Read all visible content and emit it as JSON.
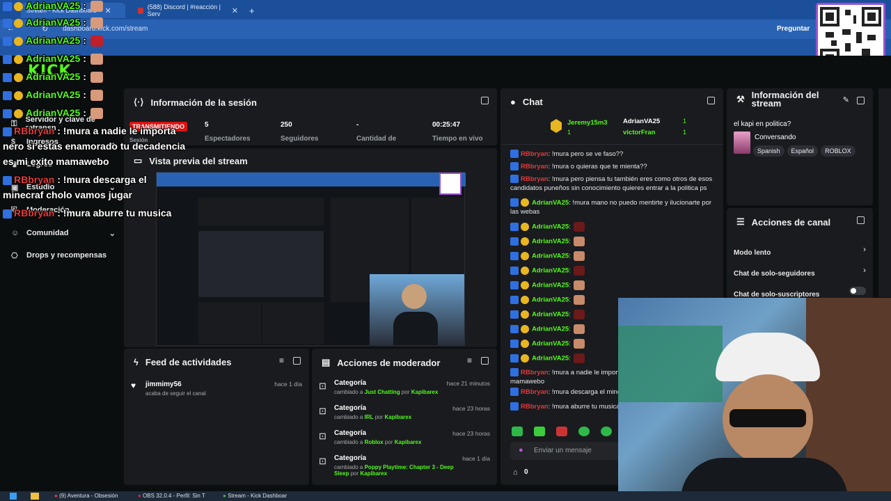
{
  "browser": {
    "tabs": [
      {
        "label": "Stream - Kick Dashboard",
        "active": true
      },
      {
        "label": "(588) Discord | #reacción | Serv",
        "active": false
      }
    ],
    "new_tab": "+",
    "url": "dashboard.kick.com/stream",
    "ask_label": "Preguntar"
  },
  "brand": {
    "logo": "KICK",
    "accent": "#53fc18"
  },
  "sidebar": {
    "items": [
      {
        "label": "Servidor y clave de retransn",
        "icon": "key-icon"
      },
      {
        "label": "Ingresos",
        "icon": "money-icon"
      },
      {
        "label": "Logros",
        "icon": "trophy-icon"
      },
      {
        "label": "Estudio",
        "icon": "studio-icon"
      },
      {
        "label": "Moderación",
        "icon": "shield-icon"
      },
      {
        "label": "Comunidad",
        "icon": "people-icon"
      },
      {
        "label": "Drops y recompensas",
        "icon": "gift-icon"
      }
    ]
  },
  "session": {
    "title": "Información de la sesión",
    "badge": "TRANSMITIENDO",
    "sub": "Sesión",
    "stats": [
      {
        "value": "5",
        "label": "Espectadores"
      },
      {
        "value": "250",
        "label": "Seguidores"
      },
      {
        "value": "-",
        "label": "Cantidad de"
      },
      {
        "value": "00:25:47",
        "label": "Tiempo en vivo"
      }
    ]
  },
  "preview": {
    "title": "Vista previa del stream"
  },
  "chat": {
    "title": "Chat",
    "top": [
      {
        "user": "Jeremy15m3",
        "count": "1"
      },
      {
        "user": "AdrianVA25",
        "count": "1"
      },
      {
        "user": "victorFran",
        "count": "1"
      }
    ],
    "messages": [
      {
        "user": "RBbryan",
        "text": ": !mura pero se ve faso??",
        "color": "red"
      },
      {
        "user": "RBbryan",
        "text": ": !mura o quieras que te mienta??",
        "color": "red"
      },
      {
        "user": "RBbryan",
        "text": ": !mura pero piensa tu también eres como otros de esos candidatos puneños sin conocimiento quieres entrar a la politica ps",
        "color": "red"
      },
      {
        "user": "AdrianVA25",
        "text": ": !mura mano no puedo mentirte y ilucionarte por las webas",
        "color": "green"
      },
      {
        "user": "AdrianVA25",
        "text": ":",
        "color": "green"
      },
      {
        "user": "AdrianVA25",
        "text": ":",
        "color": "green"
      },
      {
        "user": "AdrianVA25",
        "text": ":",
        "color": "green"
      },
      {
        "user": "AdrianVA25",
        "text": ":",
        "color": "green"
      },
      {
        "user": "AdrianVA25",
        "text": ":",
        "color": "green"
      },
      {
        "user": "AdrianVA25",
        "text": ":",
        "color": "green"
      },
      {
        "user": "AdrianVA25",
        "text": ":",
        "color": "green"
      },
      {
        "user": "AdrianVA25",
        "text": ":",
        "color": "green"
      },
      {
        "user": "AdrianVA25",
        "text": ":",
        "color": "green"
      },
      {
        "user": "AdrianVA25",
        "text": ":",
        "color": "green"
      },
      {
        "user": "RBbryan",
        "text": ": !mura a nadie le importa decadencia es mi exito mamawebo",
        "color": "red"
      },
      {
        "user": "RBbryan",
        "text": ": !mura descarga el mine",
        "color": "red"
      },
      {
        "user": "RBbryan",
        "text": ": !mura aburre tu musica",
        "color": "red"
      }
    ],
    "input_placeholder": "Enviar un mensaje",
    "points": "0"
  },
  "overlay": {
    "lines": [
      {
        "user": "AdrianVA25",
        "text": " :",
        "kind": "g"
      },
      {
        "user": "AdrianVA25",
        "text": " :",
        "kind": "g"
      },
      {
        "user": "AdrianVA25",
        "text": " :",
        "kind": "g"
      },
      {
        "user": "AdrianVA25",
        "text": " :",
        "kind": "g"
      },
      {
        "user": "AdrianVA25",
        "text": " :",
        "kind": "g"
      },
      {
        "user": "AdrianVA25",
        "text": " :",
        "kind": "g"
      },
      {
        "user": "AdrianVA25",
        "text": " :",
        "kind": "g"
      },
      {
        "user": "RBbryan",
        "text": " : !mura a nadie le importa",
        "kind": "r"
      },
      {
        "user": "",
        "text": "nero si estas enamorado tu decadencia",
        "kind": "w"
      },
      {
        "user": "",
        "text": "es mi exito mamawebo",
        "kind": "w"
      },
      {
        "user": "RBbryan",
        "text": " : !mura descarga el",
        "kind": "r"
      },
      {
        "user": "",
        "text": "minecraf cholo vamos jugar",
        "kind": "w"
      },
      {
        "user": "RBbryan",
        "text": " : !mura aburre tu musica",
        "kind": "r"
      }
    ]
  },
  "stream_info": {
    "title": "Información del stream",
    "stream_title": "el kapi en politica?",
    "category": "Conversando",
    "tags": [
      "Spanish",
      "Español",
      "ROBLOX"
    ]
  },
  "channel_actions": {
    "title": "Acciones de canal",
    "items": [
      {
        "label": "Modo lento",
        "control": "chevron"
      },
      {
        "label": "Chat de solo-seguidores",
        "control": "chevron"
      },
      {
        "label": "Chat de solo-suscriptores",
        "control": "toggle"
      }
    ]
  },
  "activity": {
    "title": "Feed de actividades",
    "items": [
      {
        "user": "jimmimy56",
        "sub": "acaba de seguir el canal",
        "time": "hace 1 día"
      }
    ]
  },
  "mod_actions": {
    "title": "Acciones de moderador",
    "items": [
      {
        "title": "Categoría",
        "prefix": "cambiado a ",
        "value": "Just Chatting",
        "by": " por ",
        "user": "Kapibarex",
        "time": "hace 21 minutos"
      },
      {
        "title": "Categoría",
        "prefix": "cambiado a ",
        "value": "IRL",
        "by": " por ",
        "user": "Kapibarex",
        "time": "hace 23 horas"
      },
      {
        "title": "Categoría",
        "prefix": "cambiado a ",
        "value": "Roblox",
        "by": " por ",
        "user": "Kapibarex",
        "time": "hace 23 horas"
      },
      {
        "title": "Categoría",
        "prefix": "cambiado a ",
        "value": "Poppy Playtime: Chapter 3 - Deep Sleep",
        "by": " por ",
        "user": "Kapibarex",
        "time": "hace 1 día"
      }
    ]
  },
  "taskbar": {
    "items": [
      "(9) Aventura - Obsesión",
      "OBS 32.0.4 - Perfil: Sin T",
      "Stream - Kick Dashboar"
    ]
  }
}
